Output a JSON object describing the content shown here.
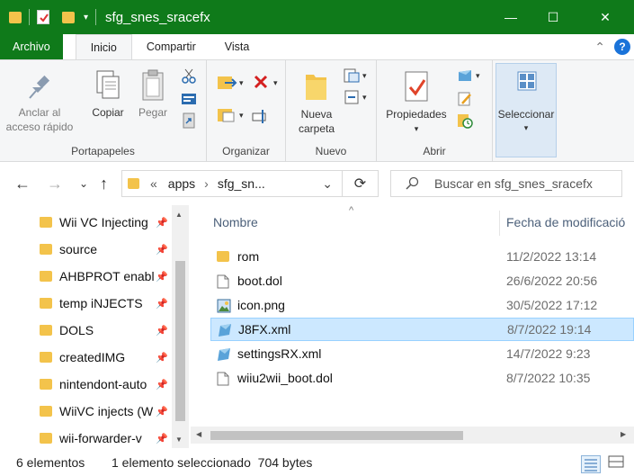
{
  "window": {
    "title": "sfg_snes_sracefx",
    "controls": {
      "minimize": "—",
      "maximize": "☐",
      "close": "✕"
    },
    "qa_dropdown": "▾"
  },
  "tabs": {
    "archivo": "Archivo",
    "inicio": "Inicio",
    "compartir": "Compartir",
    "vista": "Vista",
    "collapse": "⌃",
    "help": "?"
  },
  "ribbon": {
    "portapapeles": {
      "label": "Portapapeles",
      "pin": "Anclar al acceso rápido",
      "copy": "Copiar",
      "paste": "Pegar"
    },
    "organizar": {
      "label": "Organizar"
    },
    "nuevo": {
      "label": "Nuevo",
      "new_folder": "Nueva carpeta"
    },
    "abrir": {
      "label": "Abrir",
      "properties": "Propiedades"
    },
    "seleccionar": {
      "label": "Seleccionar"
    }
  },
  "address": {
    "back": "←",
    "forward": "→",
    "recent": "⌄",
    "up": "↑",
    "overflow": "«",
    "crumbs": [
      "apps",
      "sfg_sn..."
    ],
    "separator": "›",
    "dropdown": "⌄",
    "refresh": "⟳",
    "search_placeholder": "Buscar en sfg_snes_sracefx"
  },
  "navpane": {
    "items": [
      {
        "label": "Wii VC Injecting",
        "pin": "📌"
      },
      {
        "label": "source",
        "pin": "📌"
      },
      {
        "label": "AHBPROT enabl",
        "pin": "📌"
      },
      {
        "label": "temp iNJECTS",
        "pin": "📌"
      },
      {
        "label": "DOLS",
        "pin": "📌"
      },
      {
        "label": "createdIMG",
        "pin": "📌"
      },
      {
        "label": "nintendont-auto",
        "pin": "📌"
      },
      {
        "label": "WiiVC injects (W",
        "pin": "📌"
      },
      {
        "label": "wii-forwarder-v",
        "pin": "📌"
      }
    ],
    "scroll_up": "▲",
    "scroll_down": "▼"
  },
  "filelist": {
    "columns": {
      "name": "Nombre",
      "date": "Fecha de modificació"
    },
    "sort_indicator": "^",
    "files": [
      {
        "name": "rom",
        "date": "11/2/2022 13:14",
        "icon": "folder-icon",
        "selected": false
      },
      {
        "name": "boot.dol",
        "date": "26/6/2022 20:56",
        "icon": "file-icon",
        "selected": false
      },
      {
        "name": "icon.png",
        "date": "30/5/2022 17:12",
        "icon": "image-icon",
        "selected": false
      },
      {
        "name": "J8FX.xml",
        "date": "8/7/2022 19:14",
        "icon": "xml-icon",
        "selected": true
      },
      {
        "name": "settingsRX.xml",
        "date": "14/7/2022 9:23",
        "icon": "xml-icon",
        "selected": false
      },
      {
        "name": "wiiu2wii_boot.dol",
        "date": "8/7/2022 10:35",
        "icon": "file-icon",
        "selected": false
      }
    ],
    "scroll_left": "◀",
    "scroll_right": "▶"
  },
  "status": {
    "count": "6 elementos",
    "selection": "1 elemento seleccionado  704 bytes"
  },
  "colors": {
    "title_bar": "#0f7a1a",
    "folder": "#f3c34b",
    "selection": "#cce8ff",
    "accent": "#1a73d9"
  }
}
